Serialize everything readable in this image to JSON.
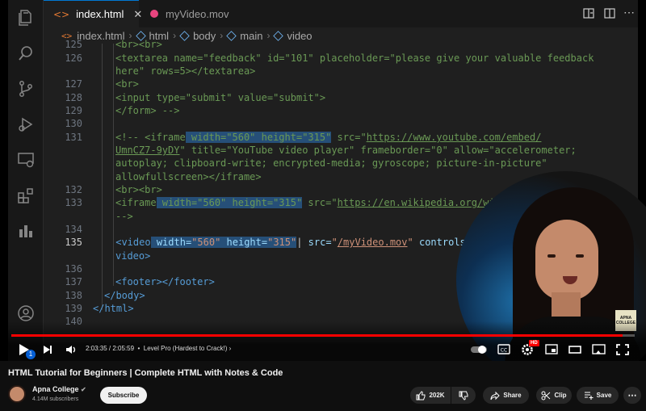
{
  "editor": {
    "tabs": [
      {
        "label": "index.html",
        "icon": "html-file-icon",
        "active": true
      },
      {
        "label": "myVideo.mov",
        "icon": "media-file-icon",
        "active": false
      }
    ],
    "breadcrumbs": [
      "index.html",
      "html",
      "body",
      "main",
      "video"
    ],
    "line_numbers": [
      "125",
      "126",
      "127",
      "128",
      "129",
      "130",
      "131",
      "132",
      "133",
      "134",
      "135",
      "136",
      "137",
      "138",
      "139",
      "140"
    ],
    "current_line": "135",
    "code": {
      "l125": "<br><br>",
      "l126a_1": "<textarea name=\"feedback\" id=\"101\" placeholder=\"please give your valuable feedback",
      "l126b": "here\" rows=5></textarea>",
      "l127": "<br>",
      "l128": "<input type=\"submit\" value=\"submit\">",
      "l129": "</form> -->",
      "l131a_pre": "<!-- <iframe",
      "l131a_hl": " width=\"560\" height=\"315\"",
      "l131a_mid": " src=\"",
      "l131a_url": "https://www.youtube.com/embed/",
      "l131b_url": "UmnCZ7-9yDY",
      "l131b_rest": "\" title=\"YouTube video player\" frameborder=\"0\" allow=\"accelerometer;",
      "l131c": "autoplay; clipboard-write; encrypted-media; gyroscope; picture-in-picture\"",
      "l131d": "allowfullscreen></iframe>",
      "l132": "<br><br>",
      "l133_pre": "<iframe",
      "l133_hl": " width=\"560\" height=\"315\"",
      "l133_mid": " src=\"",
      "l133_url": "https://en.wikipedia.org/wiki/I",
      "l133b": "-->",
      "l135_open": "<video",
      "l135_hl1": " width=",
      "l135_hl1v": "\"560\"",
      "l135_hl2": " height=",
      "l135_hl2v": "\"315\"",
      "l135_src": " src=",
      "l135_q1": "\"",
      "l135_url": "/myVideo.mov",
      "l135_q2": "\"",
      "l135_ctrl": " controls auto",
      "l135b": "video>",
      "l137": "<footer></footer>",
      "l138": "</body>",
      "l139": "</html>"
    }
  },
  "player": {
    "current_time": "2:03:35",
    "duration": "2:05:59",
    "chapter": "Level Pro (Hardest to Crack!)",
    "progress_fraction": 0.98,
    "badge": "1",
    "hd_badge": "HD",
    "cam_logo": "APNA COLLEGE"
  },
  "video": {
    "title": "HTML Tutorial for Beginners | Complete HTML with Notes & Code",
    "channel": "Apna College",
    "subscribers": "4.14M subscribers",
    "subscribe_label": "Subscribe",
    "likes": "202K",
    "share_label": "Share",
    "clip_label": "Clip",
    "save_label": "Save"
  },
  "colors": {
    "accent": "#0078d4",
    "progress": "#ff0000",
    "tab_dot": "#e8457f"
  }
}
